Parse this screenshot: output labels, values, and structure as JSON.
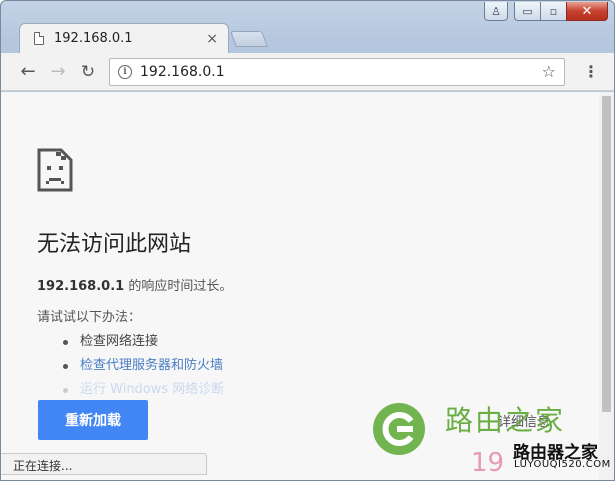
{
  "window": {
    "controls": {
      "user": "♙",
      "minimize": "▭",
      "maximize": "▫",
      "close": "✕"
    }
  },
  "tab": {
    "title": "192.168.0.1",
    "close": "×"
  },
  "toolbar": {
    "back": "←",
    "forward": "→",
    "reload": "↻",
    "url": "192.168.0.1",
    "star": "☆",
    "menu": "⋮"
  },
  "page": {
    "title": "无法访问此网站",
    "error_host": "192.168.0.1",
    "error_text": " 的响应时间过长。",
    "suggest_label": "请试试以下办法：",
    "suggestions": [
      "检查网络连接",
      "检查代理服务器和防火墙",
      "运行 Windows 网络诊断"
    ],
    "reload_button": "重新加载",
    "details_link": "详细信息"
  },
  "status": {
    "text": "正在连接..."
  },
  "watermark": {
    "cn": "路由之家",
    "cn_bold": "路由器之家",
    "domain": "LUYOUQI520.COM",
    "number": "19"
  },
  "colors": {
    "accent": "#4285f4",
    "link": "#4a7ec5",
    "watermark_green": "#5aa832"
  }
}
